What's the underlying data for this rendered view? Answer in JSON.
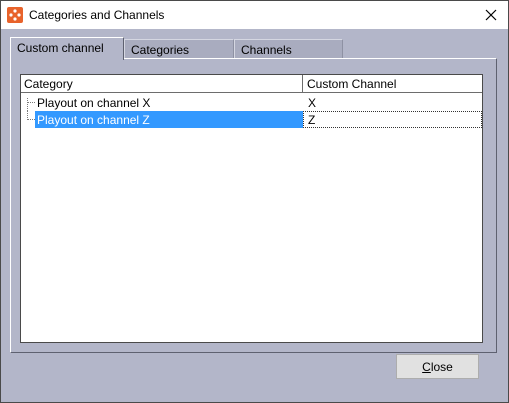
{
  "window": {
    "title": "Categories and Channels",
    "app_icon": "app-logo-icon",
    "close_icon": "close-icon"
  },
  "tabs": [
    {
      "label": "Custom channel",
      "active": true
    },
    {
      "label": "Categories",
      "active": false
    },
    {
      "label": "Channels",
      "active": false
    }
  ],
  "table": {
    "headers": [
      "Category",
      "Custom Channel"
    ],
    "rows": [
      {
        "category": "Playout on channel X",
        "channel": "X",
        "selected": false
      },
      {
        "category": "Playout on channel Z",
        "channel": "Z",
        "selected": true
      }
    ]
  },
  "buttons": {
    "close_mnemonic": "C",
    "close_rest": "lose"
  },
  "colors": {
    "selection": "#3399ff",
    "app_icon": "#e8632b",
    "window_bg": "#b3b6c9"
  }
}
